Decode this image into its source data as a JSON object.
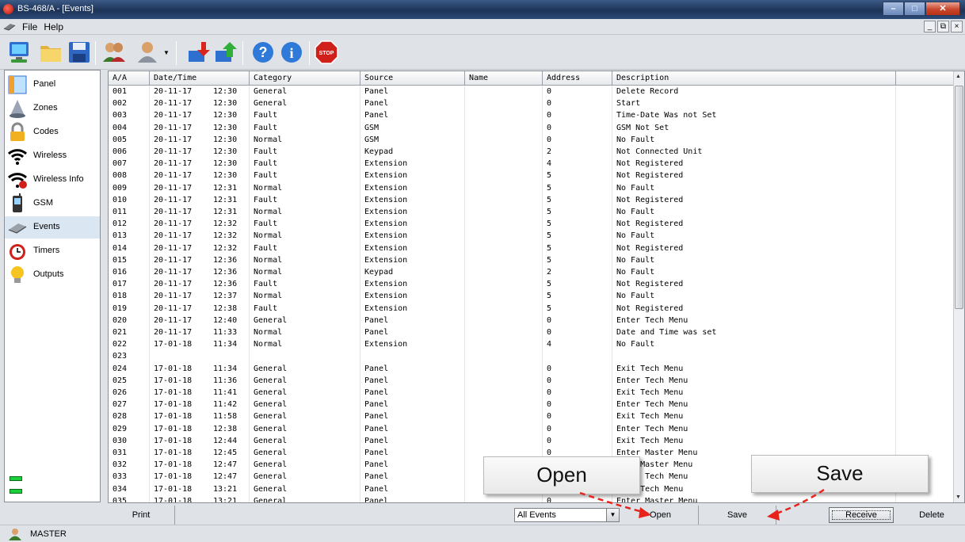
{
  "window": {
    "title": "BS-468/A - [Events]"
  },
  "menu": {
    "items": [
      "File",
      "Help"
    ]
  },
  "sidebar": {
    "items": [
      {
        "label": "Panel"
      },
      {
        "label": "Zones"
      },
      {
        "label": "Codes"
      },
      {
        "label": "Wireless"
      },
      {
        "label": "Wireless Info"
      },
      {
        "label": "GSM"
      },
      {
        "label": "Events",
        "selected": true
      },
      {
        "label": "Timers"
      },
      {
        "label": "Outputs"
      }
    ]
  },
  "table": {
    "columns": [
      "A/A",
      "Date/Time",
      "Category",
      "Source",
      "Name",
      "Address",
      "Description"
    ],
    "rows": [
      [
        "001",
        "20-11-17",
        "12:30",
        "General",
        "Panel",
        "",
        "0",
        "Delete Record"
      ],
      [
        "002",
        "20-11-17",
        "12:30",
        "General",
        "Panel",
        "",
        "0",
        "Start"
      ],
      [
        "003",
        "20-11-17",
        "12:30",
        "Fault",
        "Panel",
        "",
        "0",
        "Time-Date Was not Set"
      ],
      [
        "004",
        "20-11-17",
        "12:30",
        "Fault",
        "GSM",
        "",
        "0",
        "GSM Not Set"
      ],
      [
        "005",
        "20-11-17",
        "12:30",
        "Normal",
        "GSM",
        "",
        "0",
        "No Fault"
      ],
      [
        "006",
        "20-11-17",
        "12:30",
        "Fault",
        "Keypad",
        "",
        "2",
        "Not Connected Unit"
      ],
      [
        "007",
        "20-11-17",
        "12:30",
        "Fault",
        "Extension",
        "",
        "4",
        "Not Registered"
      ],
      [
        "008",
        "20-11-17",
        "12:30",
        "Fault",
        "Extension",
        "",
        "5",
        "Not Registered"
      ],
      [
        "009",
        "20-11-17",
        "12:31",
        "Normal",
        "Extension",
        "",
        "5",
        "No Fault"
      ],
      [
        "010",
        "20-11-17",
        "12:31",
        "Fault",
        "Extension",
        "",
        "5",
        "Not Registered"
      ],
      [
        "011",
        "20-11-17",
        "12:31",
        "Normal",
        "Extension",
        "",
        "5",
        "No Fault"
      ],
      [
        "012",
        "20-11-17",
        "12:32",
        "Fault",
        "Extension",
        "",
        "5",
        "Not Registered"
      ],
      [
        "013",
        "20-11-17",
        "12:32",
        "Normal",
        "Extension",
        "",
        "5",
        "No Fault"
      ],
      [
        "014",
        "20-11-17",
        "12:32",
        "Fault",
        "Extension",
        "",
        "5",
        "Not Registered"
      ],
      [
        "015",
        "20-11-17",
        "12:36",
        "Normal",
        "Extension",
        "",
        "5",
        "No Fault"
      ],
      [
        "016",
        "20-11-17",
        "12:36",
        "Normal",
        "Keypad",
        "",
        "2",
        "No Fault"
      ],
      [
        "017",
        "20-11-17",
        "12:36",
        "Fault",
        "Extension",
        "",
        "5",
        "Not Registered"
      ],
      [
        "018",
        "20-11-17",
        "12:37",
        "Normal",
        "Extension",
        "",
        "5",
        "No Fault"
      ],
      [
        "019",
        "20-11-17",
        "12:38",
        "Fault",
        "Extension",
        "",
        "5",
        "Not Registered"
      ],
      [
        "020",
        "20-11-17",
        "12:40",
        "General",
        "Panel",
        "",
        "0",
        "Enter Tech Menu"
      ],
      [
        "021",
        "20-11-17",
        "11:33",
        "Normal",
        "Panel",
        "",
        "0",
        "Date and Time was set"
      ],
      [
        "022",
        "17-01-18",
        "11:34",
        "Normal",
        "Extension",
        "",
        "4",
        "No Fault"
      ],
      [
        "023",
        "",
        "",
        "",
        "",
        "",
        "",
        ""
      ],
      [
        "024",
        "17-01-18",
        "11:34",
        "General",
        "Panel",
        "",
        "0",
        "Exit Tech Menu"
      ],
      [
        "025",
        "17-01-18",
        "11:36",
        "General",
        "Panel",
        "",
        "0",
        "Enter Tech Menu"
      ],
      [
        "026",
        "17-01-18",
        "11:41",
        "General",
        "Panel",
        "",
        "0",
        "Exit Tech Menu"
      ],
      [
        "027",
        "17-01-18",
        "11:42",
        "General",
        "Panel",
        "",
        "0",
        "Enter Tech Menu"
      ],
      [
        "028",
        "17-01-18",
        "11:58",
        "General",
        "Panel",
        "",
        "0",
        "Exit Tech Menu"
      ],
      [
        "029",
        "17-01-18",
        "12:38",
        "General",
        "Panel",
        "",
        "0",
        "Enter Tech Menu"
      ],
      [
        "030",
        "17-01-18",
        "12:44",
        "General",
        "Panel",
        "",
        "0",
        "Exit Tech Menu"
      ],
      [
        "031",
        "17-01-18",
        "12:45",
        "General",
        "Panel",
        "",
        "0",
        "Enter Master Menu"
      ],
      [
        "032",
        "17-01-18",
        "12:47",
        "General",
        "Panel",
        "",
        "0",
        "Exit Master Menu"
      ],
      [
        "033",
        "17-01-18",
        "12:47",
        "General",
        "Panel",
        "",
        "0",
        "Enter Tech Menu"
      ],
      [
        "034",
        "17-01-18",
        "13:21",
        "General",
        "Panel",
        "",
        "0",
        "Exit Tech Menu"
      ],
      [
        "035",
        "17-01-18",
        "13:21",
        "General",
        "Panel",
        "",
        "0",
        "Enter Master Menu"
      ]
    ]
  },
  "bottom": {
    "print": "Print",
    "filter_value": "All Events",
    "open": "Open",
    "save": "Save",
    "receive": "Receive",
    "delete": "Delete"
  },
  "status": {
    "user": "MASTER"
  },
  "callouts": {
    "open": "Open",
    "save": "Save"
  },
  "colors": {
    "annotation_arrow": "#e8231b",
    "led": "#19d03a",
    "stop_sign": "#d0201a"
  }
}
